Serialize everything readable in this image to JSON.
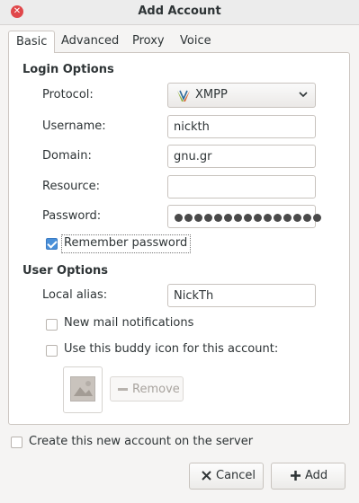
{
  "window": {
    "title": "Add Account"
  },
  "tabs": [
    {
      "label": "Basic",
      "active": true
    },
    {
      "label": "Advanced"
    },
    {
      "label": "Proxy"
    },
    {
      "label": "Voice and Video"
    }
  ],
  "login": {
    "section_title": "Login Options",
    "protocol_label": "Protocol:",
    "protocol_value": "XMPP",
    "username_label": "Username:",
    "username_value": "nickth",
    "domain_label": "Domain:",
    "domain_value": "gnu.gr",
    "resource_label": "Resource:",
    "resource_value": "",
    "password_label": "Password:",
    "password_dot_count": 15,
    "remember_label": "Remember password",
    "remember_checked": true
  },
  "user": {
    "section_title": "User Options",
    "alias_label": "Local alias:",
    "alias_value": "NickTh",
    "mail_label": "New mail notifications",
    "buddy_icon_label": "Use this buddy icon for this account:",
    "remove_label": "Remove"
  },
  "footer": {
    "create_label": "Create this new account on the server",
    "cancel_label": "Cancel",
    "add_label": "Add"
  },
  "colors": {
    "accent": "#4a90d9",
    "close": "#e0474a"
  }
}
